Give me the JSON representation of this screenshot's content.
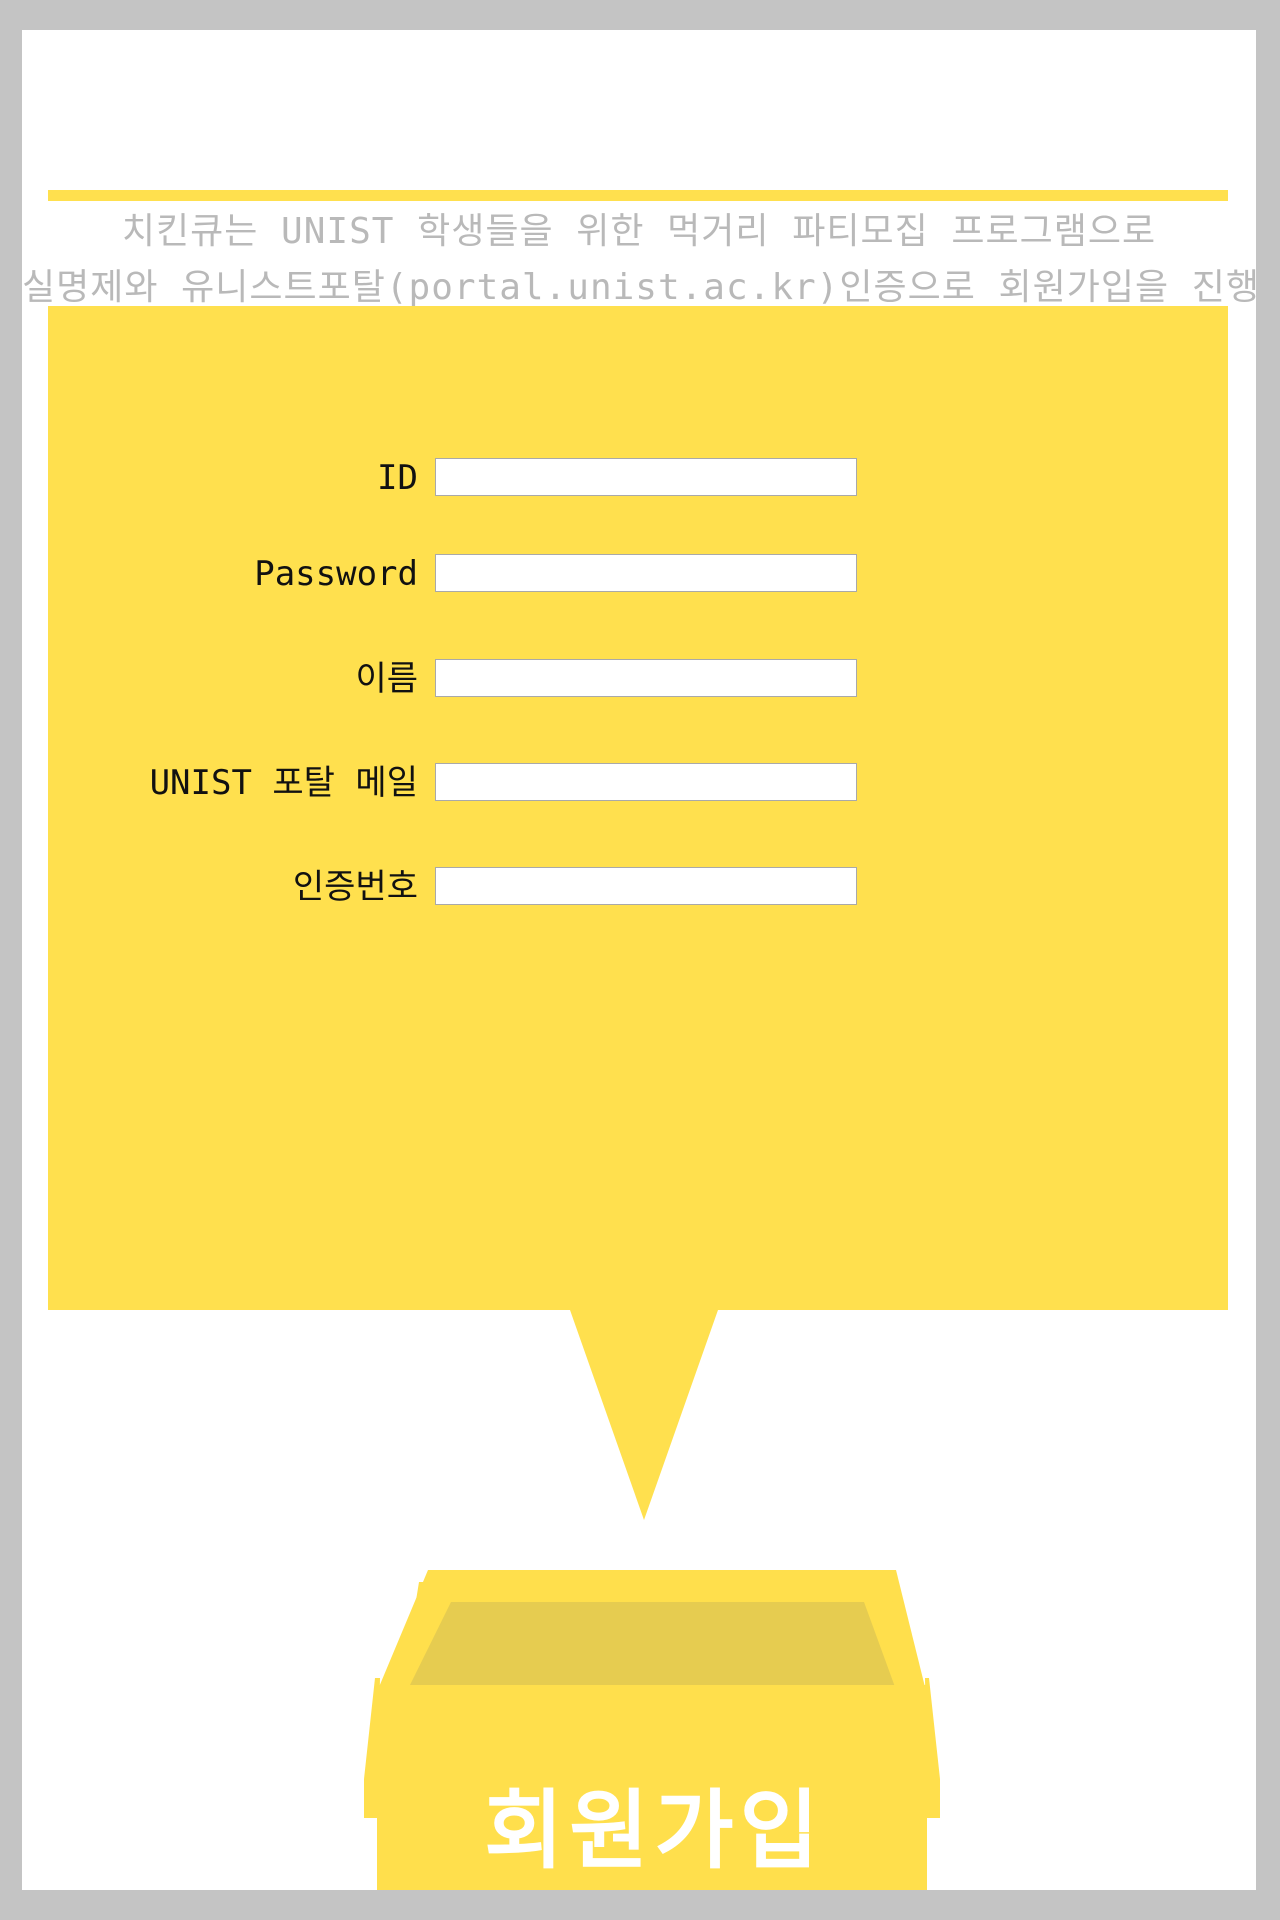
{
  "intro": {
    "line1": "치킨큐는 UNIST 학생들을 위한 먹거리 파티모집 프로그램으로",
    "line2": "실명제와 유니스트포탈(portal.unist.ac.kr)인증으로 회원가입을 진행합니다."
  },
  "form": {
    "fields": [
      {
        "label": "ID",
        "value": ""
      },
      {
        "label": "Password",
        "value": ""
      },
      {
        "label": "이름",
        "value": ""
      },
      {
        "label": "UNIST 포탈 메일",
        "value": ""
      },
      {
        "label": "인증번호",
        "value": ""
      }
    ]
  },
  "signup": {
    "label": "회원가입"
  },
  "colors": {
    "accent_yellow": "#ffe04e",
    "box_inner": "#e6cc50",
    "frame_gray": "#c4c4c4",
    "intro_text": "#b9b9b9"
  }
}
